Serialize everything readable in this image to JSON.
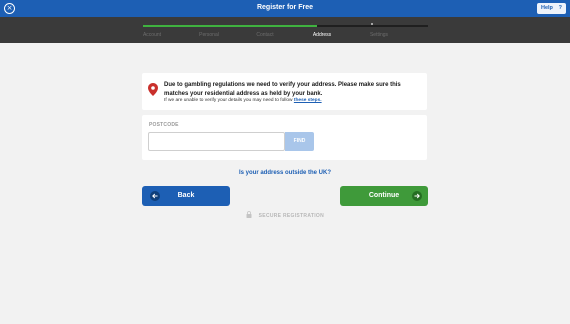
{
  "header": {
    "title": "Register for Free",
    "close_icon": "close-circle-icon",
    "help_label": "Help",
    "help_icon_glyph": "?"
  },
  "steps": {
    "progress_fraction": 0.61,
    "items": [
      {
        "label": "Account",
        "active": false
      },
      {
        "label": "Personal",
        "active": false
      },
      {
        "label": "Contact",
        "active": false
      },
      {
        "label": "Address",
        "active": true
      },
      {
        "label": "Settings",
        "active": false
      }
    ]
  },
  "notice": {
    "icon": "location-pin-icon",
    "message": "Due to gambling regulations we need to verify your address. Please make sure this matches your residential address as held by your bank.",
    "sub_text": "If we are unable to verify your details you may need to follow",
    "link_text": "these steps."
  },
  "postcode": {
    "label": "POSTCODE",
    "value": "",
    "placeholder": "",
    "find_label": "FIND"
  },
  "outside_link": "Is your address outside the UK?",
  "buttons": {
    "back_label": "Back",
    "continue_label": "Continue"
  },
  "secure_label": "SECURE REGISTRATION",
  "colors": {
    "brand_blue": "#1d5fb4",
    "progress_green": "#3fb23f",
    "continue_green": "#3f9a3a",
    "pin_red": "#c9302c"
  }
}
